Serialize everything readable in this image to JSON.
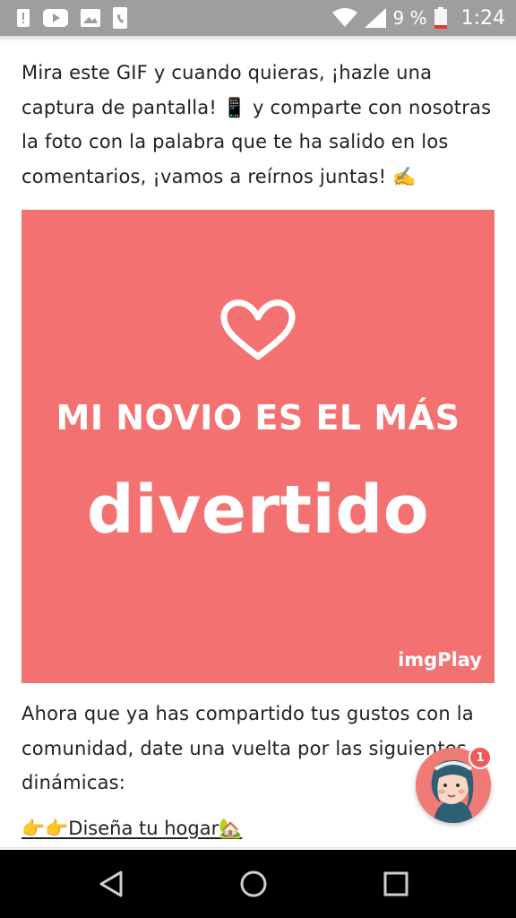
{
  "status_bar": {
    "battery_percent": "9 %",
    "time": "1:24",
    "icons": [
      "notification-alert-icon",
      "youtube-icon",
      "gallery-icon",
      "phone-icon",
      "wifi-icon",
      "signal-icon",
      "battery-low-icon"
    ]
  },
  "article": {
    "intro": "Mira este GIF y cuando quieras, ¡hazle una captura de pantalla! 📱 y comparte con nosotras la foto con la palabra que te ha salido en los comentarios, ¡vamos a reírnos juntas! ✍️",
    "gif": {
      "line1": "MI NOVIO ES EL MÁS",
      "line2": "divertido",
      "watermark": "imgPlay",
      "background": "#f47171"
    },
    "outro": "Ahora que ya has compartido tus gustos con la comunidad, date una vuelta por las siguientes dinámicas:",
    "link": "👉👉Diseña tu hogar🏡"
  },
  "chat_fab": {
    "badge_count": "1"
  },
  "nav_bar": {
    "icons": [
      "back-icon",
      "home-icon",
      "recents-icon"
    ]
  }
}
